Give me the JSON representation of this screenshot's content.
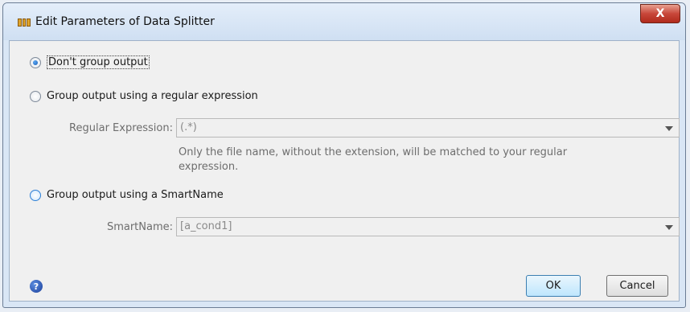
{
  "window": {
    "title": "Edit Parameters of Data Splitter",
    "close_label": "X"
  },
  "options": {
    "no_group": "Don't group output",
    "regex": "Group output using a regular expression",
    "smartname": "Group output using a SmartName"
  },
  "regex": {
    "label": "Regular Expression:",
    "value": "(.*)",
    "hint_line1": "Only the file name, without the extension, will be matched to your regular",
    "hint_line2": "expression."
  },
  "smartname": {
    "label": "SmartName:",
    "value": "[a_cond1]"
  },
  "footer": {
    "help_glyph": "?",
    "ok_label": "OK",
    "cancel_label": "Cancel"
  },
  "selected_option": "no_group"
}
